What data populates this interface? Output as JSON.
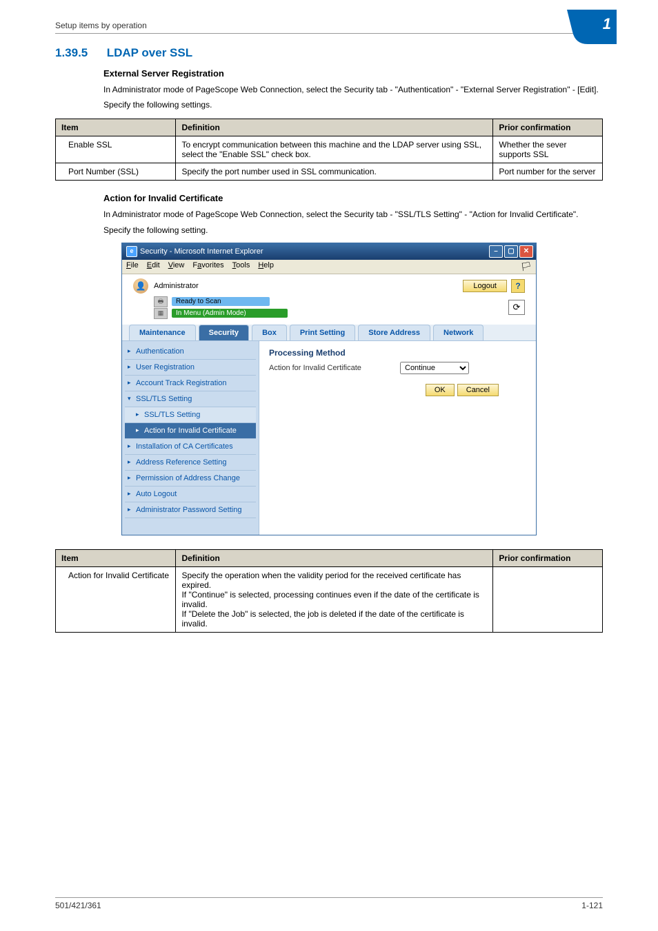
{
  "running_head": "Setup items by operation",
  "corner_number": "1",
  "section": {
    "number": "1.39.5",
    "title": "LDAP over SSL"
  },
  "reg": {
    "heading": "External Server Registration",
    "p1": "In Administrator mode of PageScope Web Connection, select the Security tab - \"Authentication\" - \"External Server Registration\" - [Edit].",
    "p2": "Specify the following settings."
  },
  "table1": {
    "head": {
      "c1": "Item",
      "c2": "Definition",
      "c3": "Prior confirmation"
    },
    "rows": [
      {
        "c1": "Enable SSL",
        "c2": "To encrypt communication between this machine and the LDAP server using SSL, select the \"Enable SSL\" check box.",
        "c3": "Whether the sever supports SSL"
      },
      {
        "c1": "Port Number (SSL)",
        "c2": "Specify the port number used in SSL communication.",
        "c3": "Port number for the server"
      }
    ]
  },
  "act": {
    "heading": "Action for Invalid Certificate",
    "p1": "In Administrator mode of PageScope Web Connection, select the Security tab - \"SSL/TLS Setting\" - \"Action for Invalid Certificate\".",
    "p2": "Specify the following setting."
  },
  "ie": {
    "window_title": "Security - Microsoft Internet Explorer",
    "menu": {
      "file": "File",
      "edit": "Edit",
      "view": "View",
      "favorites": "Favorites",
      "tools": "Tools",
      "help": "Help"
    },
    "admin_label": "Administrator",
    "logout": "Logout",
    "help": "?",
    "status_ready": "Ready to Scan",
    "status_menu": "In Menu (Admin Mode)",
    "tabs": {
      "maintenance": "Maintenance",
      "security": "Security",
      "box": "Box",
      "print": "Print Setting",
      "store": "Store Address",
      "network": "Network"
    },
    "side": {
      "authentication": "Authentication",
      "user_reg": "User Registration",
      "acct_track": "Account Track Registration",
      "ssl_setting": "SSL/TLS Setting",
      "ssl_setting_sub": "SSL/TLS Setting",
      "action_invalid": "Action for Invalid Certificate",
      "install_ca": "Installation of CA Certificates",
      "addr_ref": "Address Reference Setting",
      "perm_addr": "Permission of Address Change",
      "auto_logout": "Auto Logout",
      "admin_pw": "Administrator Password Setting"
    },
    "form": {
      "title": "Processing Method",
      "label": "Action for Invalid Certificate",
      "options": [
        "Continue",
        "Delete the Job"
      ],
      "selected": "Continue",
      "ok": "OK",
      "cancel": "Cancel"
    }
  },
  "table2": {
    "head": {
      "c1": "Item",
      "c2": "Definition",
      "c3": "Prior confirmation"
    },
    "rows": [
      {
        "c1": "Action for Invalid Certificate",
        "c2": "Specify the operation when the validity period for the received certificate has expired.\nIf \"Continue\" is selected, processing continues even if the date of the certificate is invalid.\nIf \"Delete the Job\" is selected, the job is deleted if the date of the certificate is invalid.",
        "c3": ""
      }
    ]
  },
  "footer": {
    "left": "501/421/361",
    "right": "1-121"
  }
}
